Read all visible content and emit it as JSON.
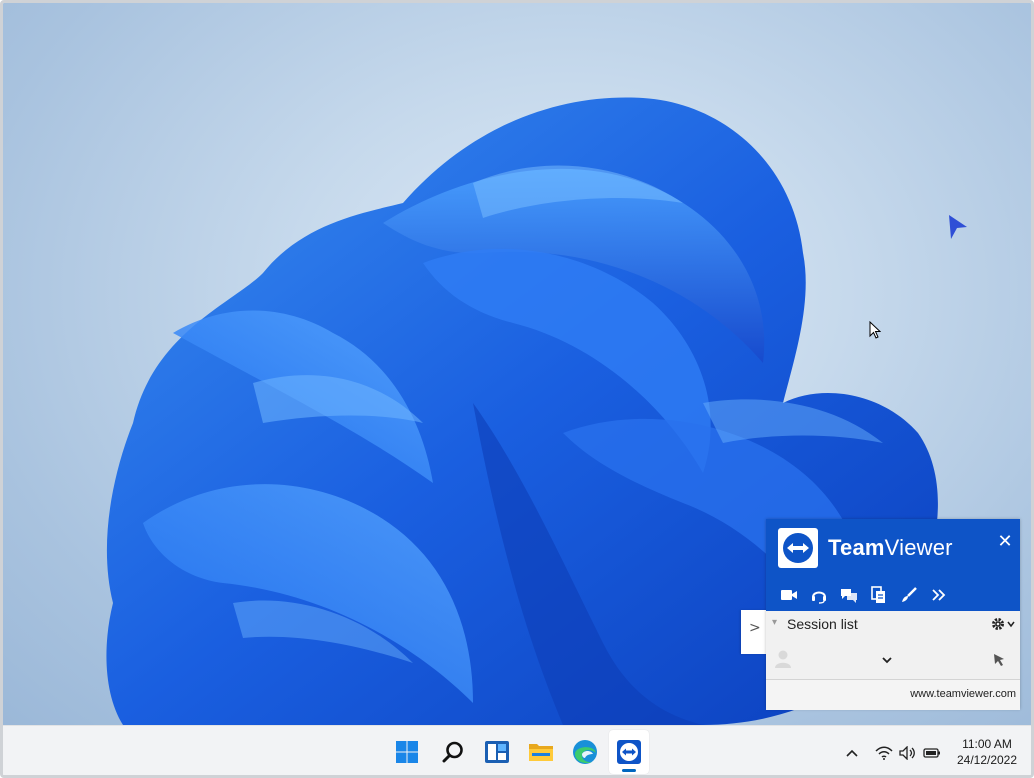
{
  "teamviewer": {
    "brand_bold": "Team",
    "brand_regular": "Viewer",
    "close_label": "✕",
    "toolbar": [
      "video",
      "headset",
      "chat",
      "file-transfer",
      "whiteboard",
      "more"
    ],
    "session_list_label": "Session list",
    "url": "www.teamviewer.com",
    "colors": {
      "header": "#0e54c7",
      "body": "#f1f1f1"
    }
  },
  "taskbar": {
    "apps": [
      "start",
      "search",
      "widgets",
      "file-explorer",
      "edge",
      "teamviewer"
    ],
    "tray": [
      "show-hidden-icons",
      "wifi",
      "volume",
      "battery"
    ],
    "clock": {
      "time": "11:00 AM",
      "date": "24/12/2022"
    }
  }
}
